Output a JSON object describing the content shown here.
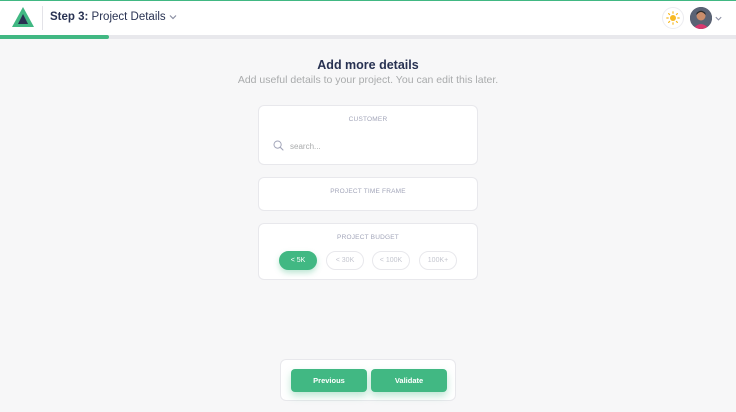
{
  "header": {
    "step_prefix": "Step 3:",
    "step_name": "Project Details",
    "colors": {
      "accent": "#41b883",
      "dark": "#283252"
    },
    "icons": [
      "logo-icon",
      "chevron-down-icon",
      "sun-icon",
      "avatar",
      "chevron-down-icon"
    ]
  },
  "progress": {
    "fraction": 0.148
  },
  "main": {
    "title": "Add more details",
    "subtitle": "Add useful details to your project. You can edit this later."
  },
  "customer": {
    "label": "Customer",
    "search_placeholder": "search..."
  },
  "timeframe": {
    "label": "Project Time Frame"
  },
  "budget": {
    "label": "Project Budget",
    "options": [
      {
        "label": "< 5K",
        "selected": true
      },
      {
        "label": "< 30K",
        "selected": false
      },
      {
        "label": "< 100K",
        "selected": false
      },
      {
        "label": "100K+",
        "selected": false
      }
    ]
  },
  "footer": {
    "previous_label": "Previous",
    "validate_label": "Validate"
  }
}
